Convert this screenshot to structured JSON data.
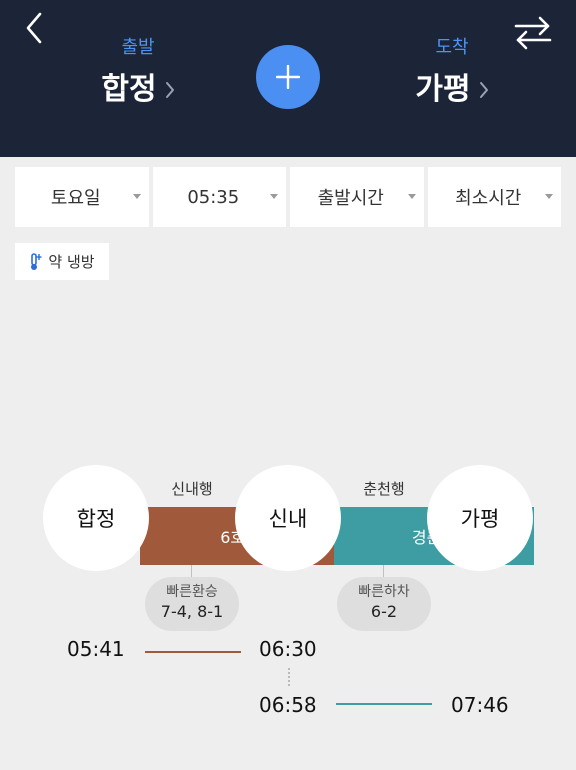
{
  "header": {
    "departure_label": "출발",
    "departure_station": "합정",
    "arrival_label": "도착",
    "arrival_station": "가평",
    "icons": [
      "back-arrow-icon",
      "swap-icon",
      "plus-icon",
      "chevron-right-icon"
    ]
  },
  "filters": [
    "토요일",
    "05:35",
    "출발시간",
    "최소시간"
  ],
  "badge": {
    "label": "약 냉방",
    "icon": "thermometer-snow-icon"
  },
  "route": {
    "stations": [
      "합정",
      "신내",
      "가평"
    ],
    "segments": [
      {
        "direction": "신내행",
        "line": "6호선",
        "color": "#a0593a"
      },
      {
        "direction": "춘천행",
        "line": "경춘선",
        "color": "#3d9da3"
      }
    ],
    "tips": [
      {
        "title": "빠른환승",
        "value": "7-4, 8-1"
      },
      {
        "title": "빠른하차",
        "value": "6-2"
      }
    ],
    "times": {
      "leg1_depart": "05:41",
      "leg1_arrive": "06:30",
      "leg2_depart": "06:58",
      "leg2_arrive": "07:46"
    }
  },
  "colors": {
    "header_bg": "#1c2538",
    "accent_blue": "#4a8ff1",
    "line6": "#a0593a",
    "gyeongchun": "#3d9da3"
  }
}
